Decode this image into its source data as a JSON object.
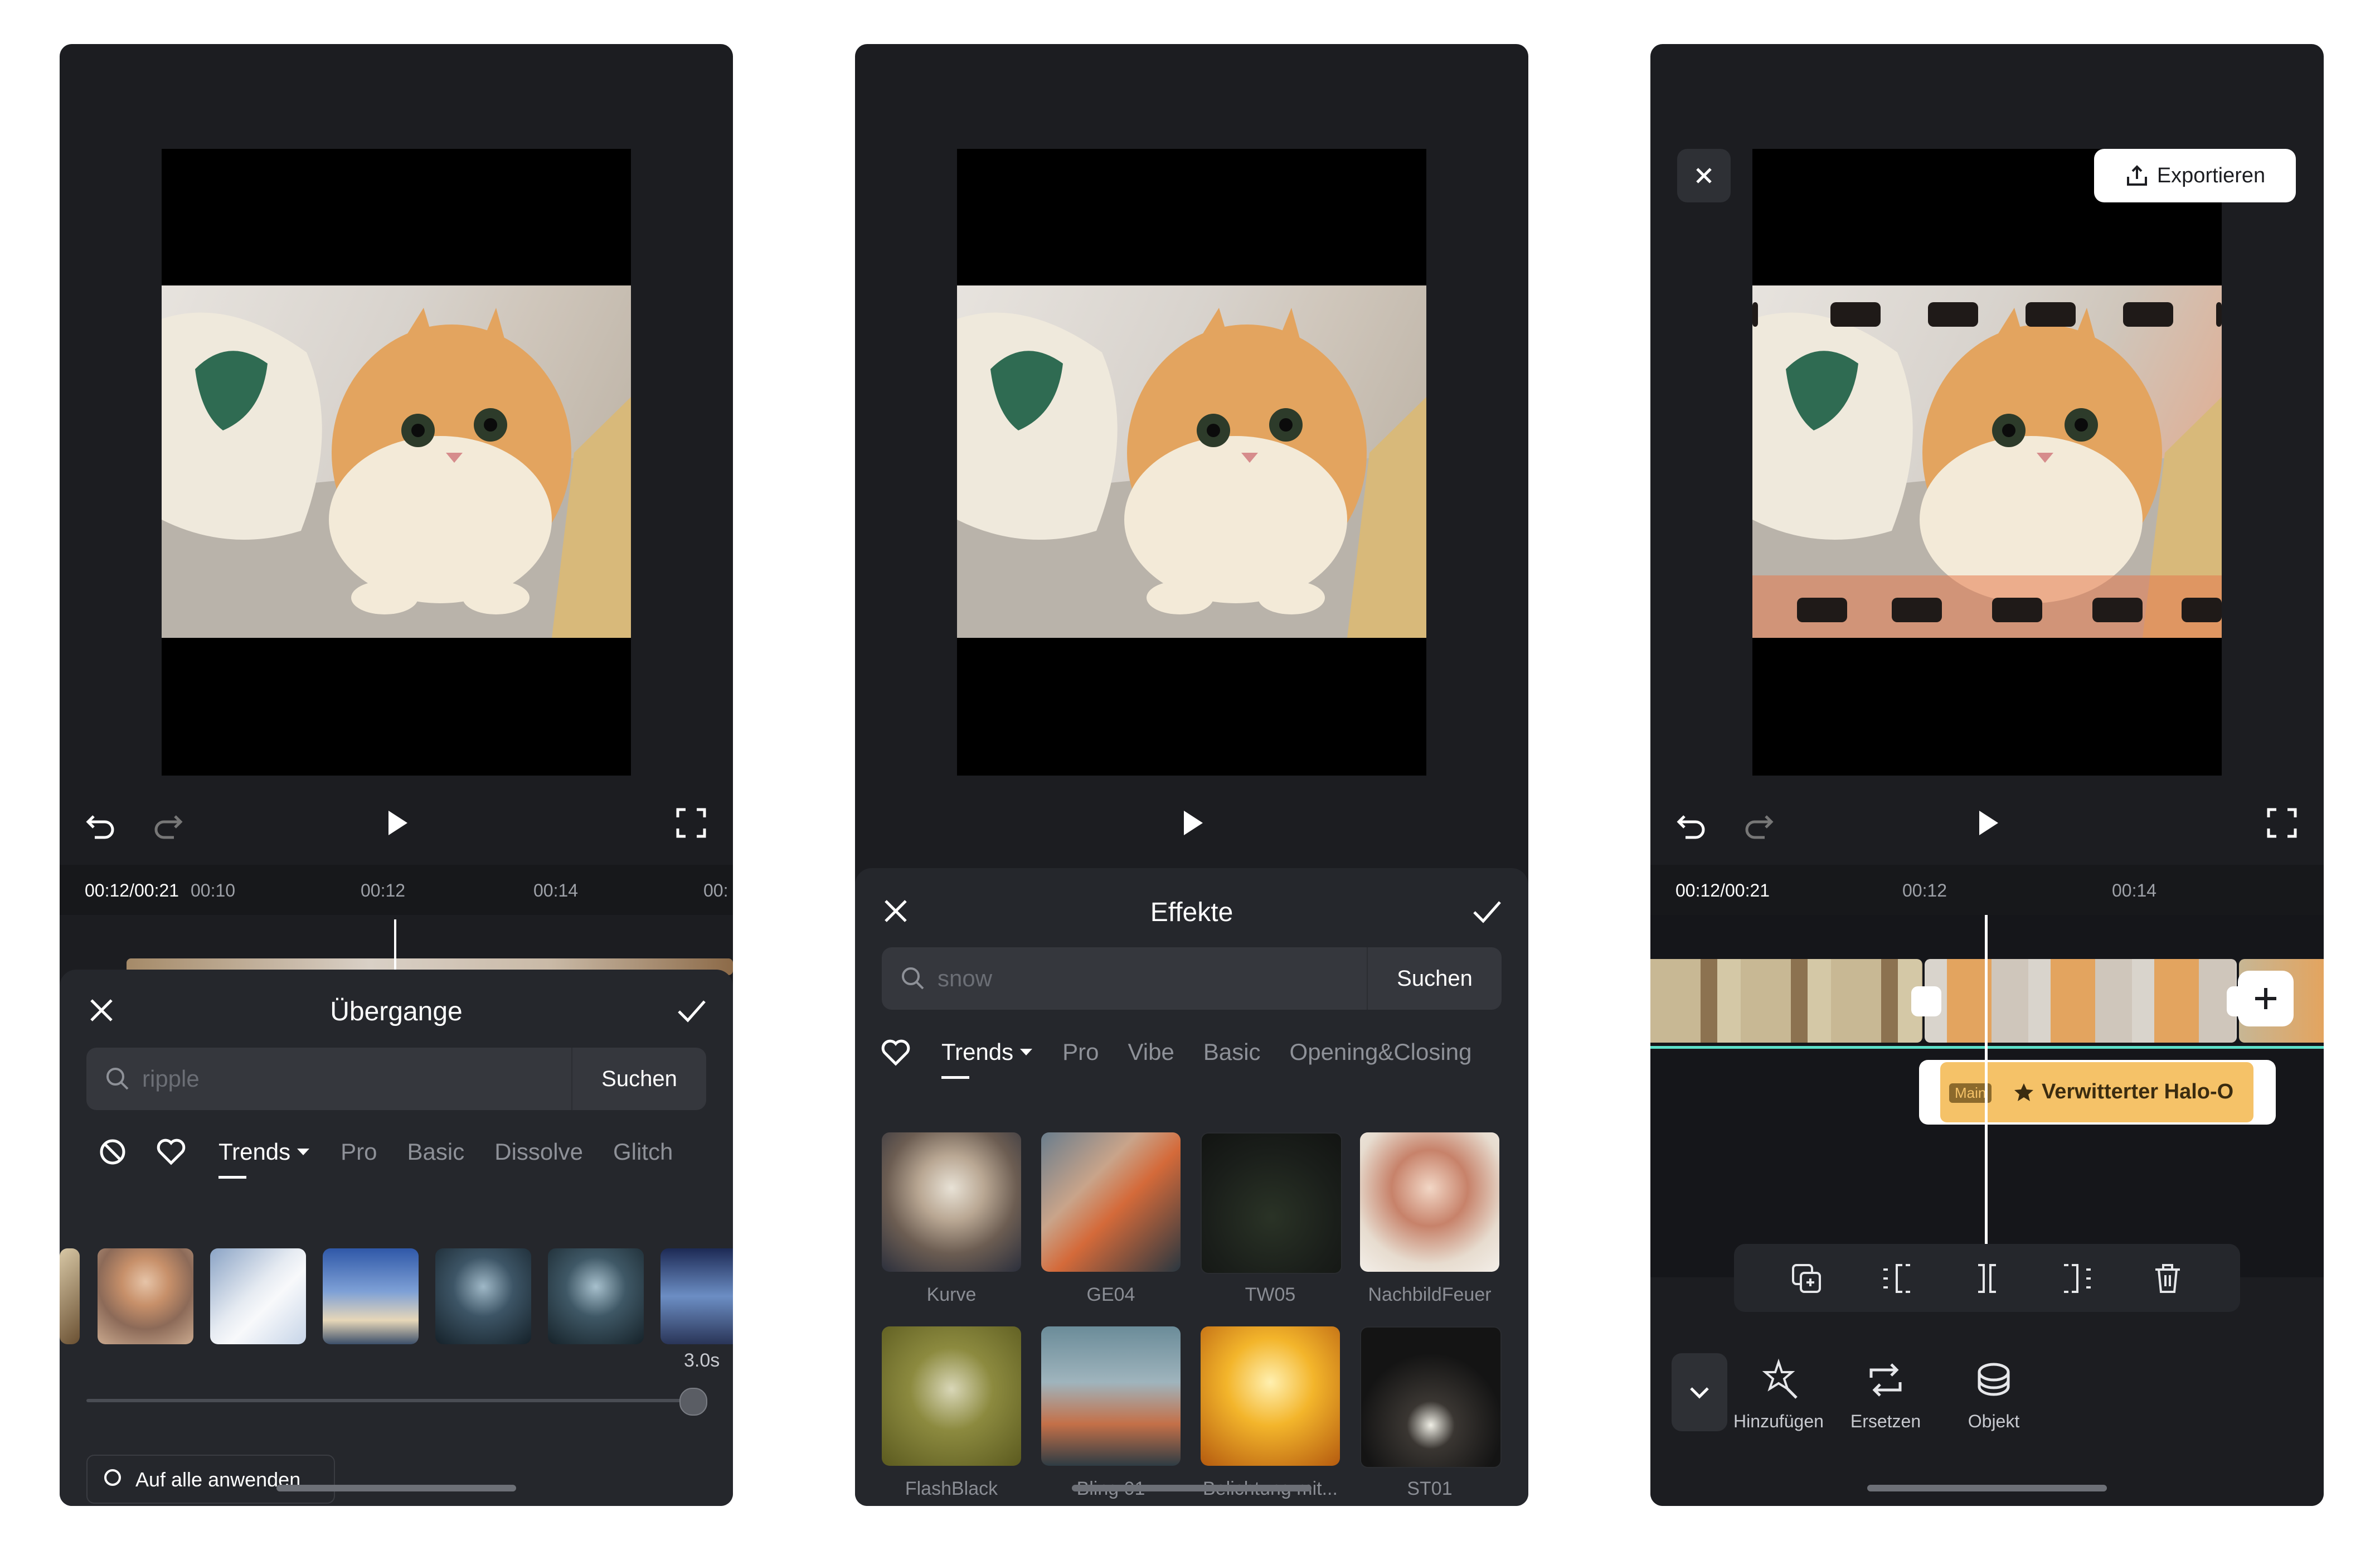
{
  "panel1": {
    "timecode": "00:12/00:21",
    "ruler_ticks": [
      "00:10",
      "00:12",
      "00:14",
      "00:"
    ],
    "title": "Übergange",
    "search": {
      "placeholder": "ripple",
      "button": "Suchen"
    },
    "tabs": [
      "Trends",
      "Pro",
      "Basic",
      "Dissolve",
      "Glitch"
    ],
    "duration": "3.0s",
    "slider_value_fraction": 1.0,
    "apply_all": "Auf alle anwenden"
  },
  "panel2": {
    "title": "Effekte",
    "search": {
      "placeholder": "snow",
      "button": "Suchen"
    },
    "tabs": [
      "Trends",
      "Pro",
      "Vibe",
      "Basic",
      "Opening&Closing"
    ],
    "effects": [
      "Kurve",
      "GE04",
      "TW05",
      "NachbildFeuer",
      "FlashBlack",
      "Bling 01",
      "Belichtung mit...",
      "ST01"
    ]
  },
  "panel3": {
    "export_label": "Exportieren",
    "timecode": "00:12/00:21",
    "ruler_ticks": [
      "00:12",
      "00:14"
    ],
    "effect_badge": "Main",
    "effect_name": "Verwitterter Halo-O",
    "tools": [
      "Hinzufügen",
      "Ersetzen",
      "Objekt"
    ]
  },
  "icons": [
    "undo-icon",
    "redo-icon",
    "play-icon",
    "fullscreen-icon",
    "close-icon",
    "check-icon",
    "search-icon",
    "no-transition-icon",
    "heart-icon",
    "chevron-down-icon",
    "export-icon",
    "add-icon",
    "copy-icon",
    "split-icon",
    "delete-icon",
    "wand-icon",
    "replace-icon",
    "object-icon"
  ],
  "colors": {
    "background": "#1c1d21",
    "sheet": "#25272c",
    "accent_track": "#f5c268",
    "timeline_line": "#5de0c9"
  }
}
